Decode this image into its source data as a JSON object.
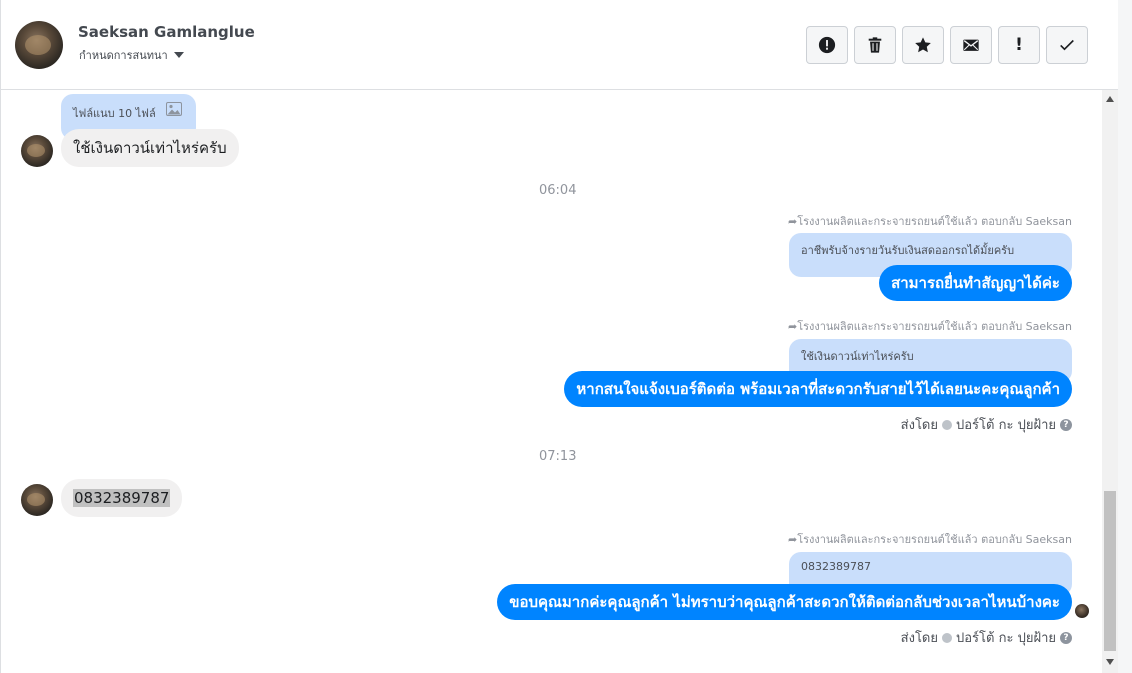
{
  "header": {
    "name": "Saeksan Gamlanglue",
    "assign_label": "กำหนดการสนทนา",
    "toolbar": [
      {
        "name": "report-button",
        "icon": "alert-circle-icon"
      },
      {
        "name": "delete-button",
        "icon": "trash-icon"
      },
      {
        "name": "star-button",
        "icon": "star-icon"
      },
      {
        "name": "mark-unread-button",
        "icon": "envelope-icon"
      },
      {
        "name": "follow-up-button",
        "icon": "exclamation-icon",
        "glyph": "!"
      },
      {
        "name": "mark-done-button",
        "icon": "checkmark-icon"
      }
    ]
  },
  "messages": {
    "m1": {
      "quote": "ไฟล์แนบ 10 ไฟล์",
      "text": "ใช้เงินดาวน์เท่าไหร่ครับ"
    },
    "time1": "06:04",
    "m2": {
      "reply_label": "โรงงานผลิตและกระจายรถยนต์ใช้แล้ว ตอบกลับ Saeksan",
      "quote": "อาชีพรับจ้างรายวันรับเงินสดออกรถได้มั้ยครับ",
      "text": "สามารถยื่นทำสัญญาได้ค่ะ"
    },
    "m3": {
      "reply_label": "โรงงานผลิตและกระจายรถยนต์ใช้แล้ว ตอบกลับ Saeksan",
      "quote": "ใช้เงินดาวน์เท่าไหร่ครับ",
      "text": "หากสนใจแจ้งเบอร์ติดต่อ พร้อมเวลาที่สะดวกรับสายไว้ได้เลยนะคะคุณลูกค้า",
      "sent_by_prefix": "ส่งโดย",
      "sent_by_name": "ปอร์โต้ กะ ปุยฝ้าย"
    },
    "time2": "07:13",
    "m4": {
      "text": "0832389787"
    },
    "m5": {
      "reply_label": "โรงงานผลิตและกระจายรถยนต์ใช้แล้ว ตอบกลับ Saeksan",
      "quote": "0832389787",
      "text": "ขอบคุณมากค่ะคุณลูกค้า ไม่ทราบว่าคุณลูกค้าสะดวกให้ติดต่อกลับช่วงเวลาไหนบ้างคะ",
      "sent_by_prefix": "ส่งโดย",
      "sent_by_name": "ปอร์โต้ กะ ปุยฝ้าย"
    }
  }
}
